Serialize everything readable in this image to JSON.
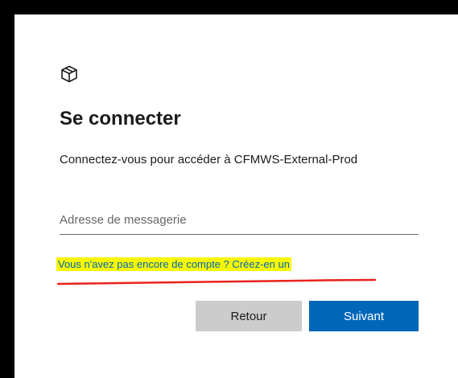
{
  "dialog": {
    "logo_icon": "package-box-icon",
    "title": "Se connecter",
    "description": "Connectez-vous pour accéder à CFMWS-External-Prod",
    "email": {
      "value": "",
      "placeholder": "Adresse de messagerie"
    },
    "create_account_link": "Vous n'avez pas encore de compte ? Créez-en un",
    "back_button": "Retour",
    "next_button": "Suivant"
  },
  "colors": {
    "accent": "#0067b8",
    "highlight": "#f7f700",
    "annotation_underline": "#e8221c",
    "secondary_button": "#cccccc",
    "frame": "#000000"
  }
}
